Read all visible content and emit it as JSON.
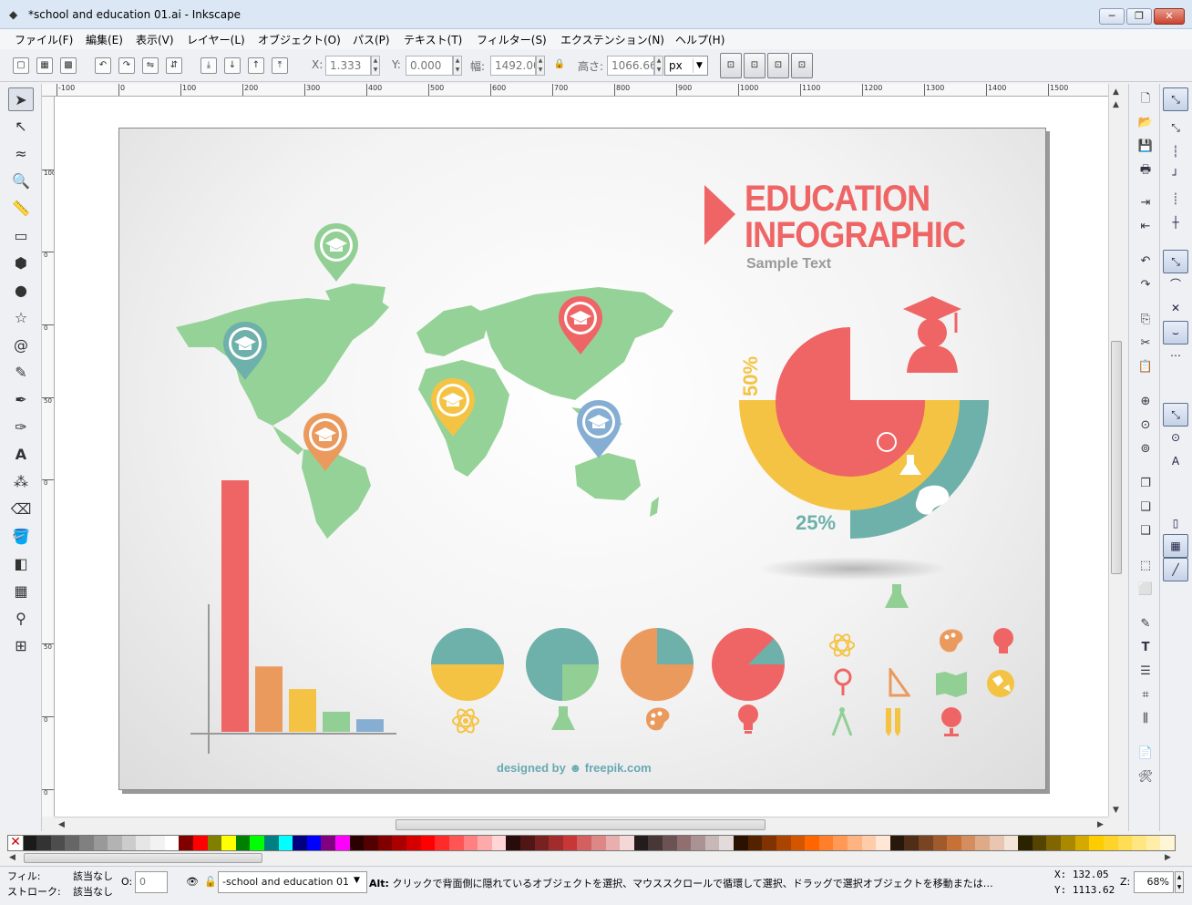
{
  "window": {
    "title": "*school and education 01.ai - Inkscape",
    "minimize": "─",
    "restore": "❐",
    "close": "✕"
  },
  "menu": [
    "ファイル(F)",
    "編集(E)",
    "表示(V)",
    "レイヤー(L)",
    "オブジェクト(O)",
    "パス(P)",
    "テキスト(T)",
    "フィルター(S)",
    "エクステンション(N)",
    "ヘルプ(H)"
  ],
  "toolctrl": {
    "x_label": "X:",
    "x_value": "1.333",
    "y_label": "Y:",
    "y_value": "0.000",
    "w_label": "幅:",
    "w_value": "1492.00",
    "h_label": "高さ:",
    "h_value": "1066.66",
    "unit": "px"
  },
  "rulers": {
    "h": [
      "-100",
      "0",
      "100",
      "200",
      "300",
      "400",
      "500",
      "600",
      "700",
      "800",
      "900",
      "1000",
      "1100",
      "1200",
      "1300",
      "1400",
      "1500"
    ],
    "v": [
      "100",
      "0",
      "0",
      "50",
      "0",
      "50",
      "0",
      "0"
    ]
  },
  "infographic": {
    "title_line1": "EDUCATION",
    "title_line2": "INFOGRAPHIC",
    "subtitle": "Sample Text",
    "pct_50": "50%",
    "pct_25": "25%",
    "credit": "designed by ☻ freepik.com",
    "colors": {
      "red": "#ef6565",
      "yellow": "#f5c343",
      "teal": "#6eb0aa",
      "green": "#92cf94",
      "orange": "#eb9a5e",
      "blue": "#86aed3",
      "map": "#95d297"
    },
    "bar_chart": {
      "values": [
        100,
        26,
        17,
        8,
        5
      ],
      "colors": [
        "#ef6565",
        "#eb9a5e",
        "#f5c343",
        "#92cf94",
        "#86aed3"
      ]
    }
  },
  "palette": [
    "#000000",
    "#1a1a1a",
    "#333333",
    "#4d4d4d",
    "#666666",
    "#808080",
    "#999999",
    "#b3b3b3",
    "#cccccc",
    "#e6e6e6",
    "#f2f2f2",
    "#ffffff",
    "#800000",
    "#ff0000",
    "#808000",
    "#ffff00",
    "#008000",
    "#00ff00",
    "#008080",
    "#00ffff",
    "#000080",
    "#0000ff",
    "#800080",
    "#ff00ff",
    "#2b0000",
    "#550000",
    "#800000",
    "#aa0000",
    "#d40000",
    "#ff0000",
    "#ff2a2a",
    "#ff5555",
    "#ff8080",
    "#ffaaaa",
    "#ffd5d5",
    "#280b0b",
    "#501616",
    "#782121",
    "#a02c2c",
    "#c83737",
    "#d35f5f",
    "#de8787",
    "#e9afaf",
    "#f4d7d7",
    "#241c1c",
    "#483737",
    "#6c5353",
    "#916f6f",
    "#ac9393",
    "#c8b7b7",
    "#e3dbdb",
    "#2b1100",
    "#552200",
    "#803300",
    "#aa4400",
    "#d45500",
    "#ff6600",
    "#ff7f2a",
    "#ff9955",
    "#ffb380",
    "#ffccaa",
    "#ffe6d5",
    "#28170b",
    "#502d16",
    "#784421",
    "#a05a2c",
    "#c87137",
    "#d38d5f",
    "#deaa87",
    "#e9c6af",
    "#f4e3d7",
    "#2b2200",
    "#554400",
    "#806600",
    "#aa8800",
    "#d4aa00",
    "#ffcc00",
    "#ffd42a",
    "#ffdd55",
    "#ffe680",
    "#ffeeaa",
    "#fff6d5"
  ],
  "status": {
    "fill_label": "フィル:",
    "fill_value": "該当なし",
    "stroke_label": "ストローク:",
    "stroke_value": "該当なし",
    "opacity_label": "O:",
    "opacity_value": "0",
    "layer_value": "-school and education 01",
    "message_bold": "Alt:",
    "message": " クリックで背面側に隠れているオブジェクトを選択、マウススクロールで循環して選択、ドラッグで選択オブジェクトを移動または…",
    "x_coord": "X:  132.05",
    "y_coord": "Y: 1113.62",
    "zoom_label": "Z:",
    "zoom_value": "68%"
  }
}
